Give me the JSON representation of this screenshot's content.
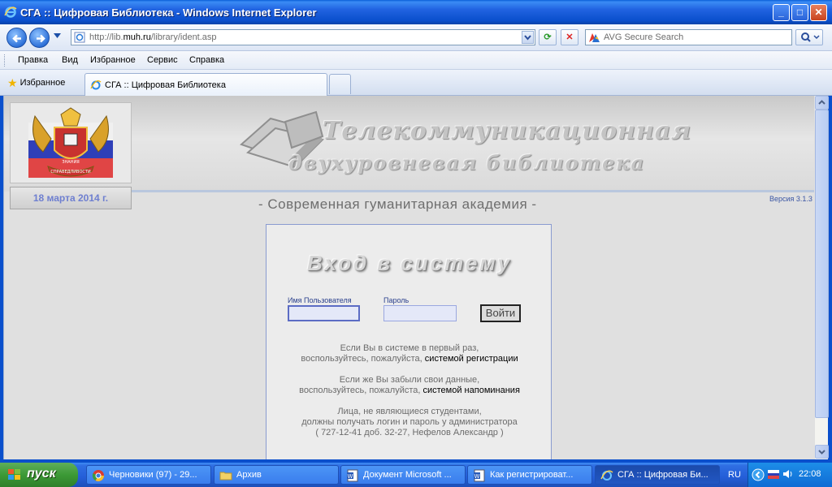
{
  "window": {
    "title": "СГА :: Цифровая Библиотека - Windows Internet Explorer",
    "minimize_label": "_",
    "maximize_label": "□",
    "close_label": "✕"
  },
  "addressbar": {
    "url_prefix": "http://lib.",
    "url_domain": "muh.ru",
    "url_suffix": "/library/ident.asp",
    "search_placeholder": "AVG Secure Search",
    "refresh_label": "⟳",
    "stop_label": "✕"
  },
  "menu": {
    "items": [
      "Правка",
      "Вид",
      "Избранное",
      "Сервис",
      "Справка"
    ]
  },
  "tabs": {
    "favorites_label": "Избранное",
    "active_tab_label": "СГА :: Цифровая Библиотека"
  },
  "page": {
    "date": "18 марта 2014 г.",
    "banner_line1": "Телекоммуникационная",
    "banner_line2": "двухуровневая библиотека",
    "academy": "- Современная гуманитарная академия -",
    "version": "Версия 3.1.3",
    "login_title": "Вход в систему",
    "username_label": "Имя Пользователя",
    "password_label": "Пароль",
    "login_button": "Войти",
    "info1_line1": "Если Вы в системе в первый раз,",
    "info1_line2": "воспользуйтесь, пожалуйста,",
    "info1_link": "системой регистрации",
    "info2_line1": "Если же Вы забыли свои данные,",
    "info2_line2": "воспользуйтесь, пожалуйста,",
    "info2_link": "системой напоминания",
    "info3_line1": "Лица, не являющиеся студентами,",
    "info3_line2": "должны получать логин и пароль у администратора",
    "info3_line3": "( 727-12-41 доб. 32-27, Нефелов Александр )",
    "logo_text_top": "ЗНАНИЯ",
    "logo_text_bottom": "СПРАВЕДЛИВОСТИ"
  },
  "taskbar": {
    "start_label": "пуск",
    "tasks": [
      {
        "label": "Черновики (97) - 29...",
        "icon": "chrome-icon"
      },
      {
        "label": "Архив",
        "icon": "folder-icon"
      },
      {
        "label": "Документ Microsoft ...",
        "icon": "word-icon"
      },
      {
        "label": "Как регистрироват...",
        "icon": "word-icon"
      },
      {
        "label": "СГА :: Цифровая Би...",
        "icon": "ie-icon"
      }
    ],
    "language": "RU",
    "clock": "22:08"
  },
  "colors": {
    "titlebar": "#2062e0",
    "date_text": "#6e7fd0",
    "version_text": "#3a55a3",
    "field_label": "#283e8c"
  }
}
